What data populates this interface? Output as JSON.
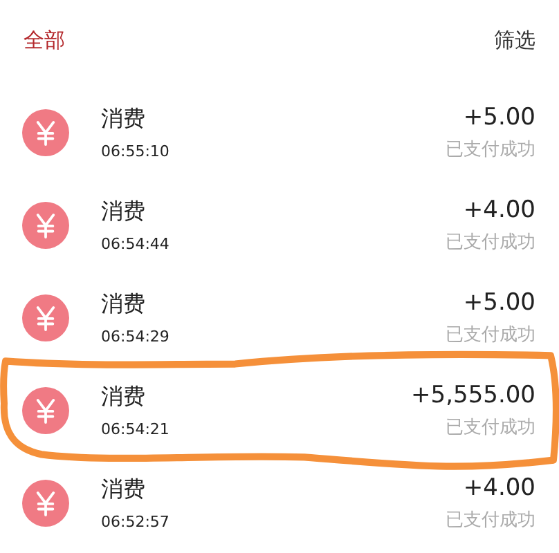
{
  "header": {
    "tabs": [
      {
        "label": "全部",
        "selected": true
      }
    ],
    "filter": "筛选"
  },
  "transactions": [
    {
      "title": "消费",
      "time": "06:55:10",
      "amount": "+5.00",
      "status": "已支付成功",
      "circled": false
    },
    {
      "title": "消费",
      "time": "06:54:44",
      "amount": "+4.00",
      "status": "已支付成功",
      "circled": false
    },
    {
      "title": "消费",
      "time": "06:54:29",
      "amount": "+5.00",
      "status": "已支付成功",
      "circled": false
    },
    {
      "title": "消费",
      "time": "06:54:21",
      "amount": "+5,555.00",
      "status": "已支付成功",
      "circled": true
    },
    {
      "title": "消费",
      "time": "06:52:57",
      "amount": "+4.00",
      "status": "已支付成功",
      "circled": false
    }
  ]
}
